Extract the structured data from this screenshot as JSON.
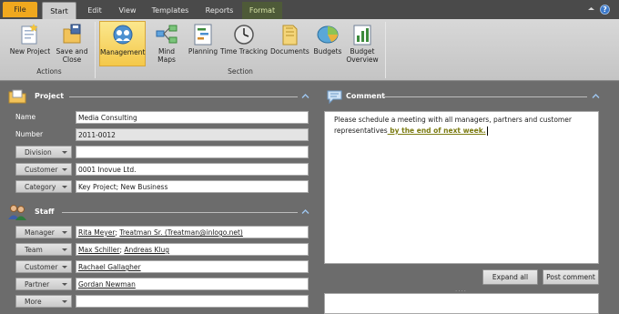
{
  "tabs": [
    {
      "label": "File"
    },
    {
      "label": "Start"
    },
    {
      "label": "Edit"
    },
    {
      "label": "View"
    },
    {
      "label": "Templates"
    },
    {
      "label": "Reports"
    },
    {
      "label": "Format"
    }
  ],
  "ribbon": {
    "new_project": "New Project",
    "save_close_1": "Save and",
    "save_close_2": "Close",
    "actions_group": "Actions",
    "management": "Management",
    "mind_maps": "Mind Maps",
    "planning": "Planning",
    "time_tracking": "Time Tracking",
    "documents": "Documents",
    "budgets": "Budgets",
    "budget_overview_1": "Budget",
    "budget_overview_2": "Overview",
    "section_group": "Section"
  },
  "project": {
    "title": "Project",
    "name_label": "Name",
    "name_value": "Media Consulting",
    "number_label": "Number",
    "number_value": "2011-0012",
    "division_label": "Division",
    "division_value": "",
    "customer_label": "Customer",
    "customer_value": "0001 Inovue Ltd.",
    "category_label": "Category",
    "category_value": "Key Project; New Business"
  },
  "staff": {
    "title": "Staff",
    "manager_label": "Manager",
    "manager_a": "Rita Meyer",
    "manager_sep": ";  ",
    "manager_b": "Treatman Sr. (Treatman@inlogo.net)",
    "team_label": "Team",
    "team_a": "Max Schiller",
    "team_sep": ";  ",
    "team_b": "Andreas Klug",
    "customer_label": "Customer",
    "customer_value": "Rachael Gallagher",
    "partner_label": "Partner",
    "partner_value": "Gordan Newman",
    "more_label": "More",
    "more_value": ""
  },
  "comment": {
    "title": "Comment",
    "text": "Please schedule a meeting with all managers, partners and customer representatives",
    "highlight": " by the end of next week.",
    "expand_all": "Expand all",
    "post_comment": "Post comment",
    "grip": "...."
  },
  "colors": {
    "file_tab": "#f0a81e",
    "active_button": "#f4c84a",
    "highlight_text": "#7a7a10",
    "background": "#6c6c6c"
  }
}
